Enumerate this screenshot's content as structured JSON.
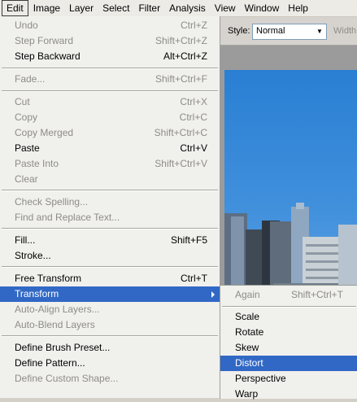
{
  "menubar": {
    "items": [
      "Edit",
      "Image",
      "Layer",
      "Select",
      "Filter",
      "Analysis",
      "View",
      "Window",
      "Help"
    ]
  },
  "options_bar": {
    "style_label": "Style:",
    "style_value": "Normal",
    "width_label": "Width:"
  },
  "edit_menu": {
    "undo": {
      "label": "Undo",
      "shortcut": "Ctrl+Z"
    },
    "step_forward": {
      "label": "Step Forward",
      "shortcut": "Shift+Ctrl+Z"
    },
    "step_backward": {
      "label": "Step Backward",
      "shortcut": "Alt+Ctrl+Z"
    },
    "fade": {
      "label": "Fade...",
      "shortcut": "Shift+Ctrl+F"
    },
    "cut": {
      "label": "Cut",
      "shortcut": "Ctrl+X"
    },
    "copy": {
      "label": "Copy",
      "shortcut": "Ctrl+C"
    },
    "copy_merged": {
      "label": "Copy Merged",
      "shortcut": "Shift+Ctrl+C"
    },
    "paste": {
      "label": "Paste",
      "shortcut": "Ctrl+V"
    },
    "paste_into": {
      "label": "Paste Into",
      "shortcut": "Shift+Ctrl+V"
    },
    "clear": {
      "label": "Clear"
    },
    "check_spelling": {
      "label": "Check Spelling..."
    },
    "find_replace": {
      "label": "Find and Replace Text..."
    },
    "fill": {
      "label": "Fill...",
      "shortcut": "Shift+F5"
    },
    "stroke": {
      "label": "Stroke..."
    },
    "free_transform": {
      "label": "Free Transform",
      "shortcut": "Ctrl+T"
    },
    "transform": {
      "label": "Transform"
    },
    "auto_align": {
      "label": "Auto-Align Layers..."
    },
    "auto_blend": {
      "label": "Auto-Blend Layers"
    },
    "define_brush": {
      "label": "Define Brush Preset..."
    },
    "define_pattern": {
      "label": "Define Pattern..."
    },
    "define_shape": {
      "label": "Define Custom Shape..."
    }
  },
  "transform_submenu": {
    "again": {
      "label": "Again",
      "shortcut": "Shift+Ctrl+T"
    },
    "scale": {
      "label": "Scale"
    },
    "rotate": {
      "label": "Rotate"
    },
    "skew": {
      "label": "Skew"
    },
    "distort": {
      "label": "Distort"
    },
    "perspective": {
      "label": "Perspective"
    },
    "warp": {
      "label": "Warp"
    }
  }
}
